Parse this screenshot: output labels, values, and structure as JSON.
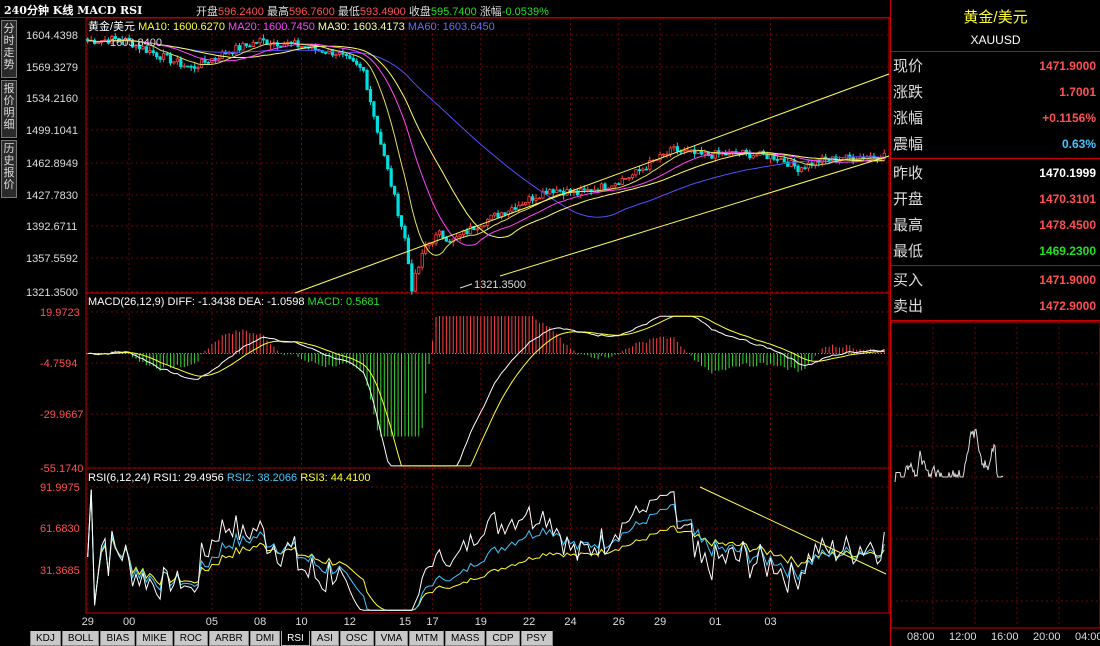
{
  "topbar": {
    "title": "240分钟 K线 MACD RSI",
    "open_label": "开盘",
    "open_value": "596.2400",
    "high_label": "最高",
    "high_value": "596.7600",
    "low_label": "最低",
    "low_value": "593.4900",
    "close_label": "收盘",
    "close_value": "595.7400",
    "change_label": "涨幅",
    "change_value": "-0.0539%"
  },
  "side_tabs": [
    "分时走势",
    "报价明细",
    "历史报价"
  ],
  "legend_main": {
    "symbol": "黄金/美元",
    "ma10": "MA10: 1600.6270",
    "ma20": "MA20: 1600.7450",
    "ma30": "MA30: 1603.4173",
    "ma60": "MA60: 1603.6450"
  },
  "legend_macd": {
    "name": "MACD(26,12,9)",
    "diff": "DIFF: -1.3438",
    "dea": "DEA: -1.0598",
    "macd": "MACD: 0.5681"
  },
  "legend_rsi": {
    "name": "RSI(6,12,24)",
    "rsi1": "RSI1: 29.4956",
    "rsi2": "RSI2: 38.2066",
    "rsi3": "RSI3: 44.4100"
  },
  "annotations": {
    "high_mark": "1603.8400",
    "low_mark": "1321.3500"
  },
  "bottom_tabs": [
    "KDJ",
    "BOLL",
    "BIAS",
    "MIKE",
    "ROC",
    "ARBR",
    "DMI",
    "RSI",
    "ASI",
    "OSC",
    "VMA",
    "MTM",
    "MASS",
    "CDP",
    "PSY"
  ],
  "bottom_tab_active": "RSI",
  "quote_panel": {
    "name": "黄金/美元",
    "code": "XAUUSD",
    "groups": [
      [
        {
          "label": "现价",
          "value": "1471.9000",
          "color": "#ff5050"
        },
        {
          "label": "涨跌",
          "value": "1.7001",
          "color": "#ff5050"
        },
        {
          "label": "涨幅",
          "value": "+0.1156%",
          "color": "#ff5050"
        },
        {
          "label": "震幅",
          "value": "0.63%",
          "color": "#3ec8ff"
        }
      ],
      [
        {
          "label": "昨收",
          "value": "1470.1999",
          "color": "#ffffff"
        },
        {
          "label": "开盘",
          "value": "1470.3101",
          "color": "#ff5050"
        },
        {
          "label": "最高",
          "value": "1478.4500",
          "color": "#ff5050"
        },
        {
          "label": "最低",
          "value": "1469.2300",
          "color": "#22e022"
        }
      ],
      [
        {
          "label": "买入",
          "value": "1471.9000",
          "color": "#ff5050"
        },
        {
          "label": "卖出",
          "value": "1472.9000",
          "color": "#ff5050"
        }
      ]
    ],
    "time_labels": [
      "08:00",
      "12:00",
      "16:00",
      "20:00",
      "04:00"
    ]
  },
  "colors": {
    "up": "#ff4040",
    "down": "#00e0e0",
    "ma10": "#ffff33",
    "ma20": "#ff44ff",
    "ma30": "#ffff66",
    "ma60": "#5050ff",
    "grid": "#7a0000",
    "axis": "#cc0000",
    "trend": "#ffff55",
    "macd_pos": "#ff4040",
    "macd_neg": "#33dd33",
    "rsi1": "#ffffff",
    "rsi2": "#3ec8ff",
    "rsi3": "#ffff33"
  },
  "chart_data": [
    {
      "type": "candlestick",
      "title": "黄金/美元",
      "x_ticks": [
        "29",
        "00",
        "05",
        "08",
        "10",
        "12",
        "15",
        "17",
        "19",
        "22",
        "24",
        "26",
        "29",
        "01",
        "03"
      ],
      "y_ticks": [
        "1604.4398",
        "1569.3279",
        "1534.2160",
        "1499.1041",
        "1462.8949",
        "1427.7830",
        "1392.6711",
        "1357.5592",
        "1321.3500"
      ],
      "ylim": [
        1321.35,
        1604.44
      ],
      "grid": true,
      "anchor_prices": [
        [
          0,
          1598
        ],
        [
          10,
          1600
        ],
        [
          22,
          1580
        ],
        [
          30,
          1568
        ],
        [
          40,
          1585
        ],
        [
          50,
          1598
        ],
        [
          60,
          1594
        ],
        [
          67,
          1588
        ],
        [
          72,
          1585
        ],
        [
          80,
          1565
        ],
        [
          84,
          1500
        ],
        [
          88,
          1440
        ],
        [
          92,
          1380
        ],
        [
          94,
          1326
        ],
        [
          98,
          1372
        ],
        [
          102,
          1385
        ],
        [
          106,
          1378
        ],
        [
          112,
          1393
        ],
        [
          118,
          1405
        ],
        [
          126,
          1420
        ],
        [
          134,
          1435
        ],
        [
          142,
          1430
        ],
        [
          150,
          1438
        ],
        [
          158,
          1450
        ],
        [
          164,
          1465
        ],
        [
          170,
          1478
        ],
        [
          178,
          1472
        ],
        [
          190,
          1474
        ],
        [
          200,
          1470
        ],
        [
          206,
          1458
        ],
        [
          212,
          1466
        ],
        [
          224,
          1470
        ],
        [
          230,
          1472
        ]
      ],
      "channel_upper": [
        [
          1321.35,
          1321.35
        ],
        [
          1566.0,
          1566.0
        ]
      ],
      "channel_lower": [
        [
          1348.0,
          1348.0
        ],
        [
          1462.0,
          1462.0
        ]
      ],
      "ma_series": [
        "MA10",
        "MA20",
        "MA30",
        "MA60"
      ]
    },
    {
      "type": "bar",
      "title": "MACD(26,12,9)",
      "y_ticks": [
        "19.9723",
        "-4.7594",
        "-29.9667",
        "-55.1740"
      ],
      "ylim": [
        -55.174,
        19.9723
      ],
      "series": [
        {
          "name": "DIFF"
        },
        {
          "name": "DEA"
        },
        {
          "name": "MACD"
        }
      ]
    },
    {
      "type": "line",
      "title": "RSI(6,12,24)",
      "y_ticks": [
        "91.9975",
        "61.6830",
        "31.3685"
      ],
      "ylim": [
        10,
        100
      ],
      "series": [
        {
          "name": "RSI1"
        },
        {
          "name": "RSI2"
        },
        {
          "name": "RSI3"
        }
      ]
    }
  ]
}
